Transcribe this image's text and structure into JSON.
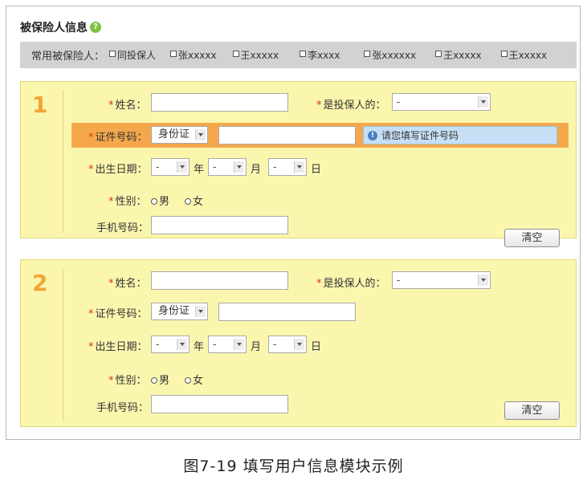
{
  "section": {
    "title": "被保险人信息",
    "help_icon": "help-circle-icon"
  },
  "common_insured": {
    "label": "常用被保险人：",
    "options": [
      "同投保人",
      "张xxxxx",
      "王xxxxx",
      "李xxxx",
      "张xxxxxx",
      "王xxxxx",
      "王xxxxx"
    ]
  },
  "persons": [
    {
      "number": "1",
      "name_label": "姓名：",
      "is_holder_label": "是投保人的：",
      "is_holder_value": "-",
      "id_label": "证件号码：",
      "id_type": "身份证",
      "id_tip": "请您填写证件号码",
      "birth_label": "出生日期：",
      "year_value": "-",
      "year_unit": "年",
      "month_value": "-",
      "month_unit": "月",
      "day_value": "-",
      "day_unit": "日",
      "gender_label": "性别：",
      "gender_male": "男",
      "gender_female": "女",
      "phone_label": "手机号码：",
      "clear_label": "清空"
    },
    {
      "number": "2",
      "name_label": "姓名：",
      "is_holder_label": "是投保人的：",
      "is_holder_value": "-",
      "id_label": "证件号码：",
      "id_type": "身份证",
      "birth_label": "出生日期：",
      "year_value": "-",
      "year_unit": "年",
      "month_value": "-",
      "month_unit": "月",
      "day_value": "-",
      "day_unit": "日",
      "gender_label": "性别：",
      "gender_male": "男",
      "gender_female": "女",
      "phone_label": "手机号码：",
      "clear_label": "清空"
    }
  ],
  "caption": "图7-19 填写用户信息模块示例",
  "colors": {
    "panel": "#fbf6ae",
    "highlight": "#f5a84b",
    "number": "#f0a637",
    "required": "#d9341c",
    "tip": "#c7dff4"
  }
}
